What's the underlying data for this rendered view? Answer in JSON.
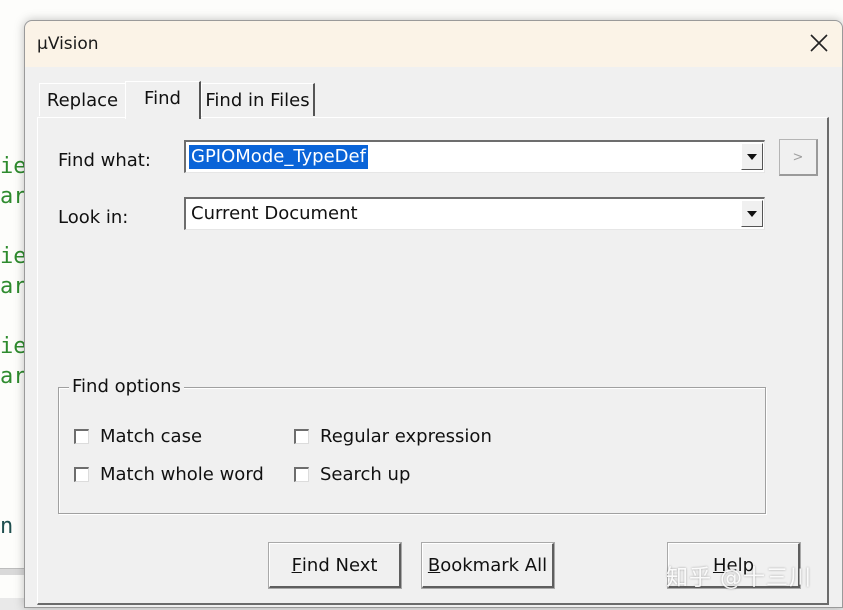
{
  "background": {
    "code_fragments": [
      "ie",
      "ar",
      "ie",
      "ar",
      "ie",
      "ar",
      "n"
    ]
  },
  "dialog": {
    "title": "µVision",
    "close_icon": "close-icon",
    "tabs": [
      {
        "label": "Replace",
        "active": false
      },
      {
        "label": "Find",
        "active": true
      },
      {
        "label": "Find in Files",
        "active": false
      }
    ],
    "find_what": {
      "label": "Find what:",
      "value": "GPIOMode_TypeDef"
    },
    "look_in": {
      "label": "Look in:",
      "value": "Current Document"
    },
    "regex_helper_label": ">",
    "find_options": {
      "title": "Find options",
      "options": [
        {
          "label": "Match case",
          "checked": false
        },
        {
          "label": "Match whole word",
          "checked": false
        },
        {
          "label": "Regular expression",
          "checked": false
        },
        {
          "label": "Search up",
          "checked": false
        }
      ]
    },
    "buttons": {
      "find_next_accel": "F",
      "find_next_rest": "ind Next",
      "bookmark_all_accel": "B",
      "bookmark_all_rest": "ookmark All",
      "help_accel": "H",
      "help_rest": "elp"
    }
  },
  "watermark": "知乎 @十三川",
  "colors": {
    "selection": "#0a64d8",
    "titlebar": "#fbf3e7",
    "dialog_bg": "#f0f0f0",
    "code_green": "#2e8b2e"
  }
}
